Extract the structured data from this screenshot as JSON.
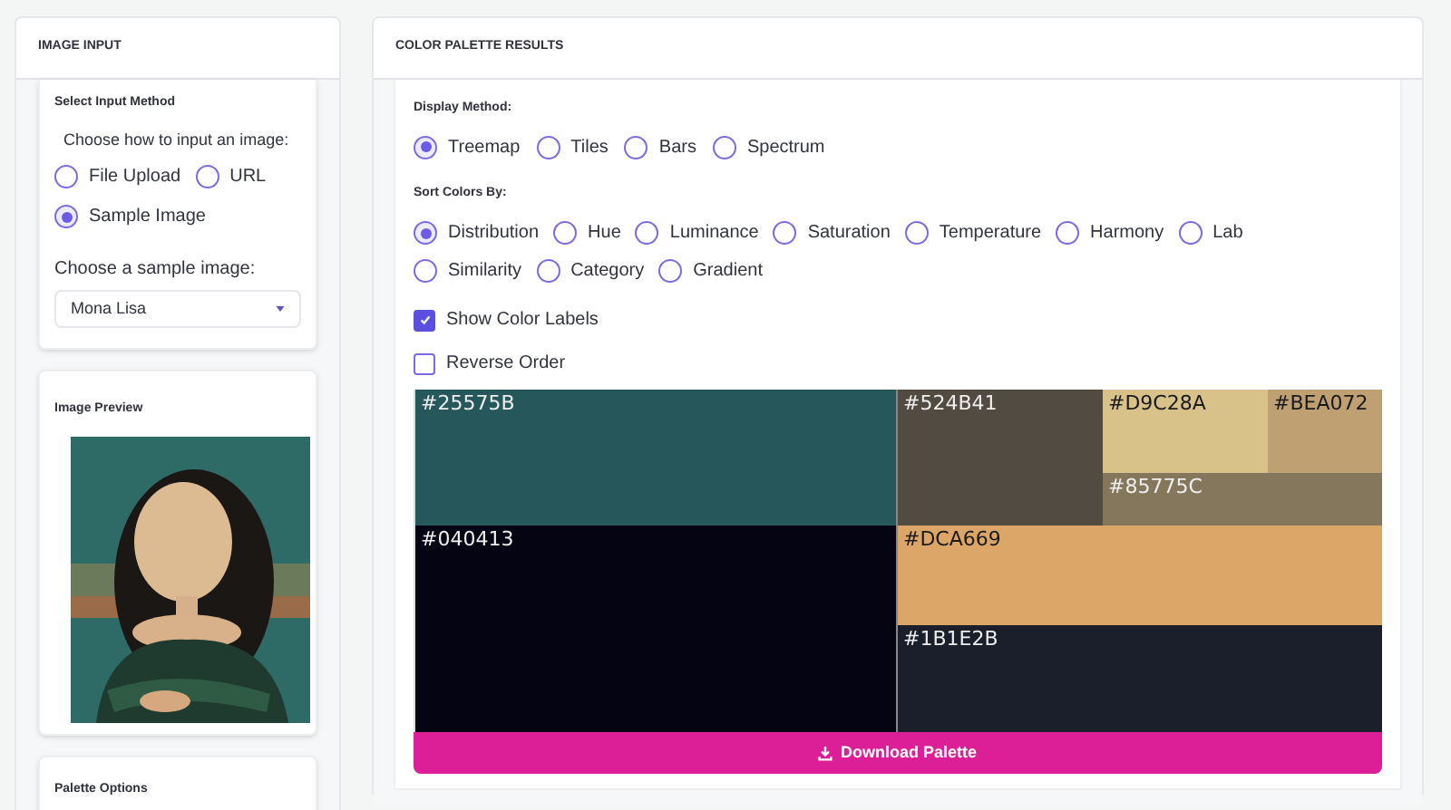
{
  "left_panel": {
    "title": "IMAGE INPUT",
    "input_method": {
      "title": "Select Input Method",
      "prompt": "Choose how to input an image:",
      "options": [
        {
          "label": "File Upload",
          "selected": false
        },
        {
          "label": "URL",
          "selected": false
        },
        {
          "label": "Sample Image",
          "selected": true
        }
      ],
      "sample_label": "Choose a sample image:",
      "sample_value": "Mona Lisa"
    },
    "preview": {
      "title": "Image Preview"
    },
    "palette_options": {
      "title": "Palette Options"
    }
  },
  "right_panel": {
    "title": "COLOR PALETTE RESULTS",
    "display_method": {
      "label": "Display Method:",
      "options": [
        {
          "label": "Treemap",
          "selected": true
        },
        {
          "label": "Tiles",
          "selected": false
        },
        {
          "label": "Bars",
          "selected": false
        },
        {
          "label": "Spectrum",
          "selected": false
        }
      ]
    },
    "sort_by": {
      "label": "Sort Colors By:",
      "options": [
        {
          "label": "Distribution",
          "selected": true
        },
        {
          "label": "Hue",
          "selected": false
        },
        {
          "label": "Luminance",
          "selected": false
        },
        {
          "label": "Saturation",
          "selected": false
        },
        {
          "label": "Temperature",
          "selected": false
        },
        {
          "label": "Harmony",
          "selected": false
        },
        {
          "label": "Lab",
          "selected": false
        },
        {
          "label": "Similarity",
          "selected": false
        },
        {
          "label": "Category",
          "selected": false
        },
        {
          "label": "Gradient",
          "selected": false
        }
      ]
    },
    "checkboxes": [
      {
        "label": "Show Color Labels",
        "checked": true
      },
      {
        "label": "Reverse Order",
        "checked": false
      }
    ],
    "treemap": [
      {
        "label": "#25575B",
        "color": "#25575b"
      },
      {
        "label": "#040413",
        "color": "#040413"
      },
      {
        "label": "#524B41",
        "color": "#524b41"
      },
      {
        "label": "#D9C28A",
        "color": "#d9c28a"
      },
      {
        "label": "#BEA072",
        "color": "#bea072"
      },
      {
        "label": "#85775C",
        "color": "#85775c"
      },
      {
        "label": "#DCA669",
        "color": "#dca669"
      },
      {
        "label": "#1B1E2B",
        "color": "#1b1e2b"
      }
    ],
    "download_button": "Download Palette"
  }
}
